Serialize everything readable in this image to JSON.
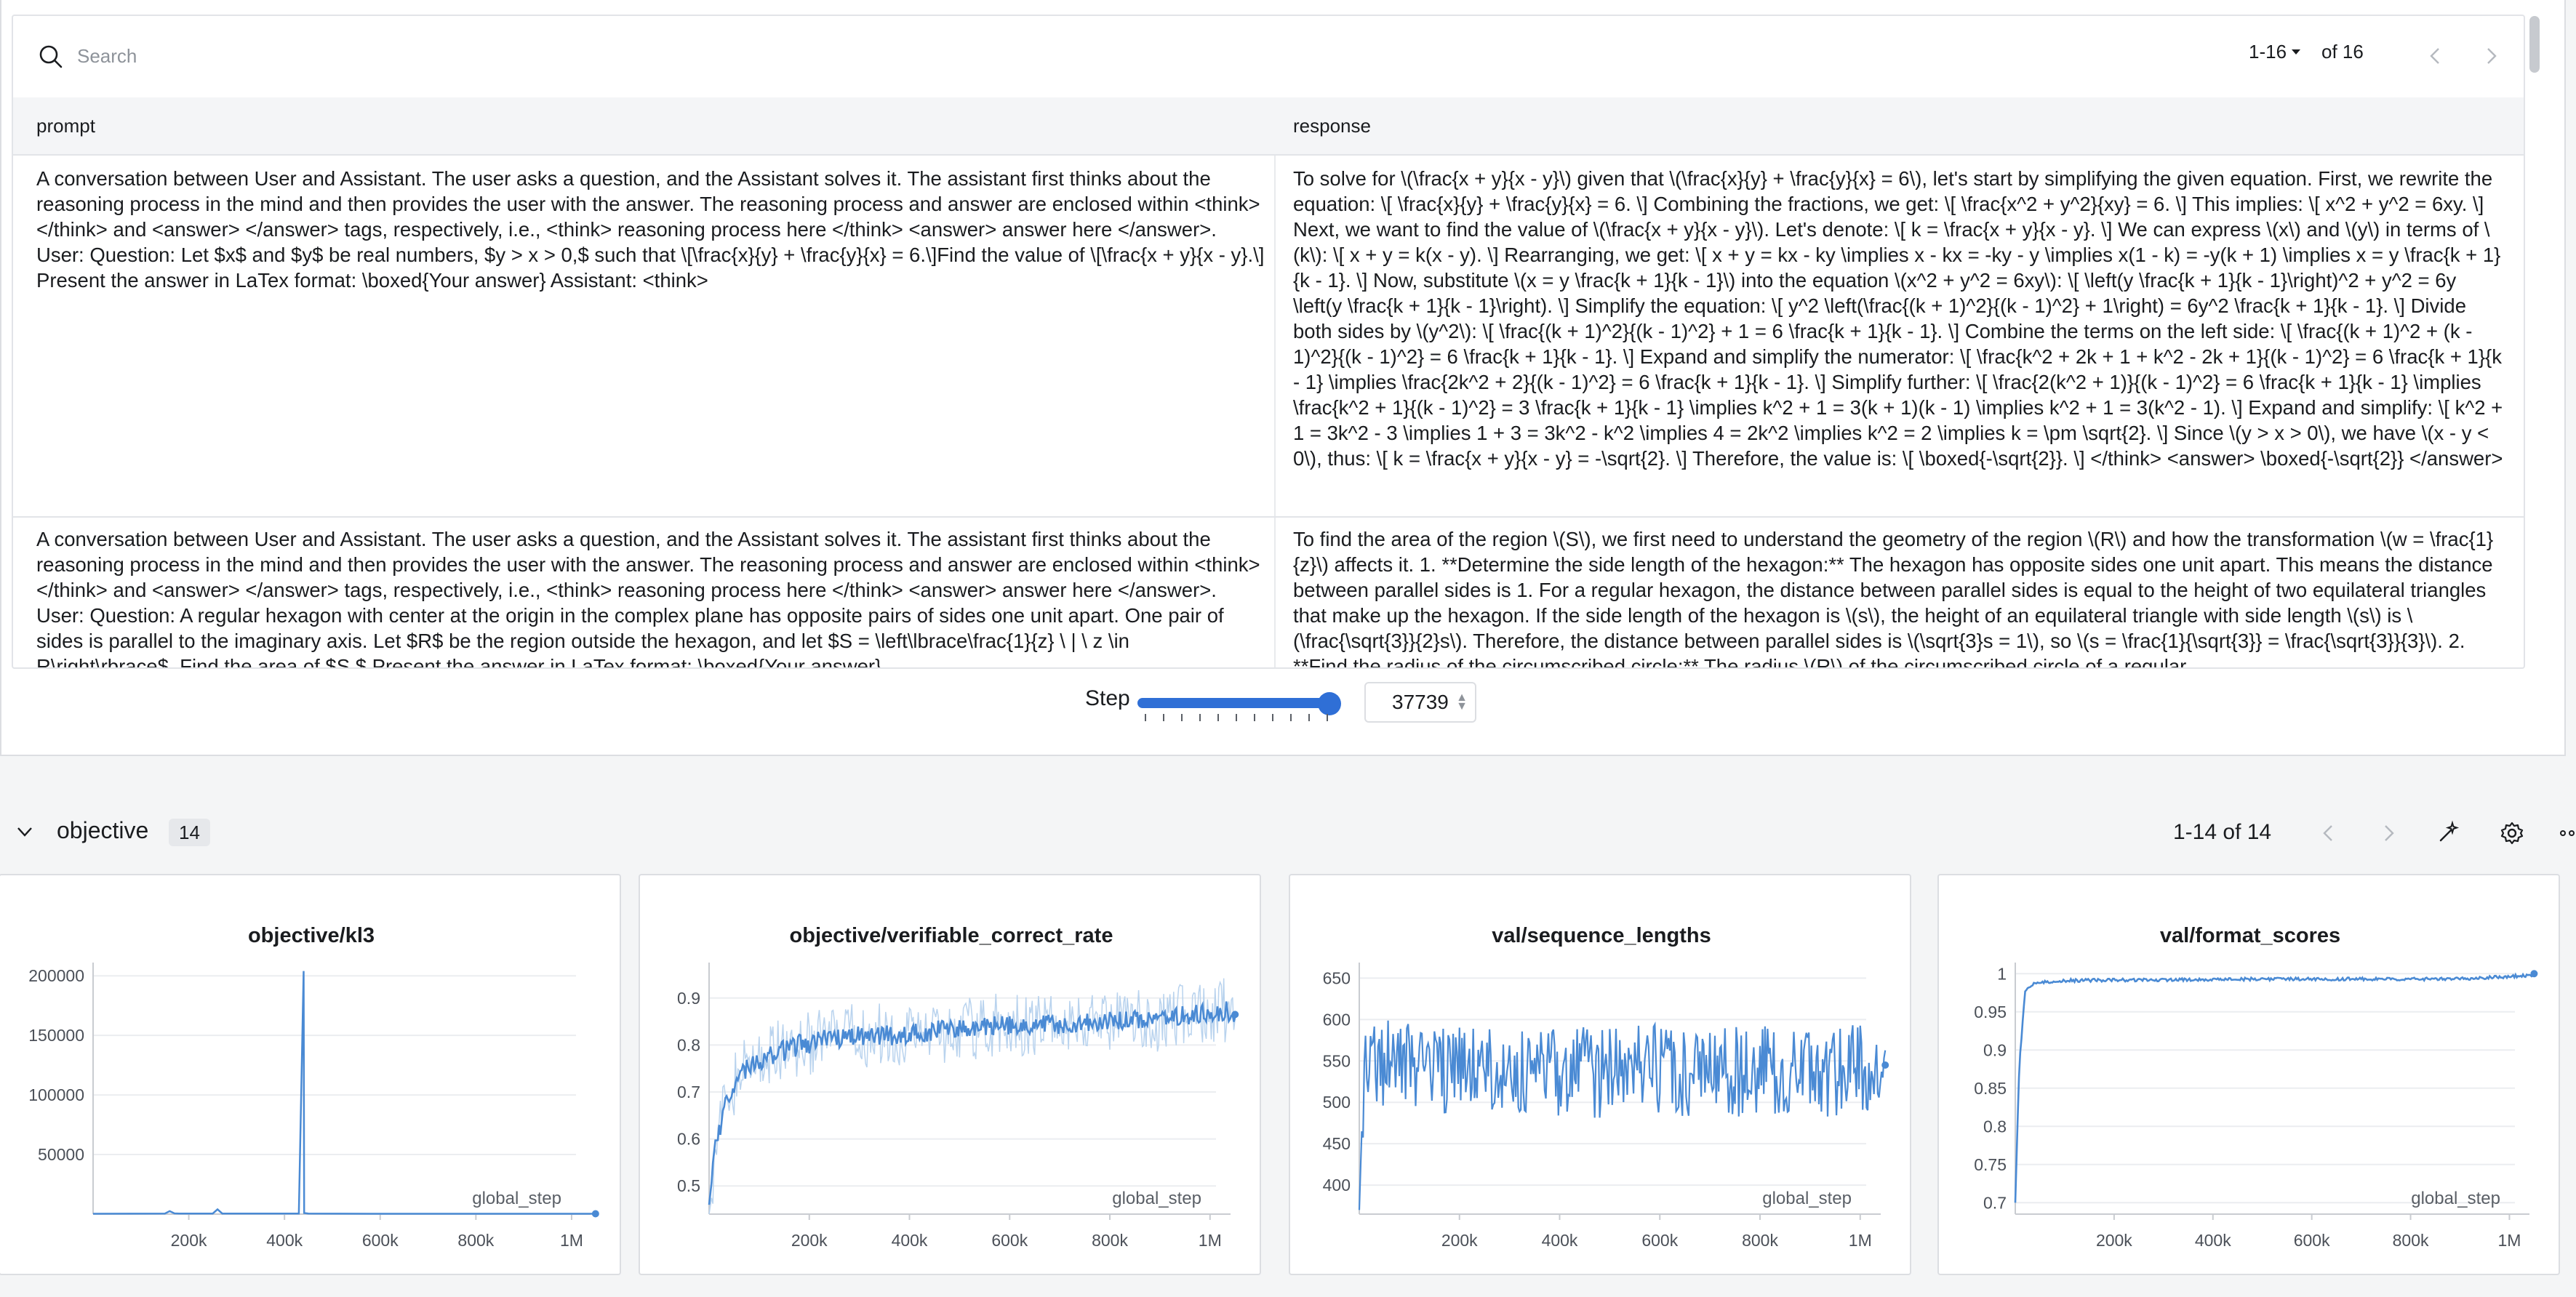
{
  "search": {
    "placeholder": "Search",
    "value": ""
  },
  "pager": {
    "range": "1-16",
    "of": "of 16"
  },
  "table": {
    "columns": [
      "prompt",
      "response"
    ],
    "rows": [
      {
        "prompt": "A conversation between User and Assistant. The user asks a question, and the Assistant solves it. The assistant first thinks about the reasoning process in the mind and then provides the user with the answer. The reasoning process and answer are enclosed within <think> </think> and <answer> </answer> tags, respectively, i.e., <think> reasoning process here </think> <answer> answer here </answer>. User: Question: Let $x$ and $y$ be real numbers, $y > x > 0,$ such that \\[\\frac{x}{y} + \\frac{y}{x} = 6.\\]Find the value of \\[\\frac{x + y}{x - y}.\\] Present the answer in LaTex format: \\boxed{Your answer} Assistant: <think>",
        "response": "To solve for \\(\\frac{x + y}{x - y}\\) given that \\(\\frac{x}{y} + \\frac{y}{x} = 6\\), let's start by simplifying the given equation. First, we rewrite the equation: \\[ \\frac{x}{y} + \\frac{y}{x} = 6. \\] Combining the fractions, we get: \\[ \\frac{x^2 + y^2}{xy} = 6. \\] This implies: \\[ x^2 + y^2 = 6xy. \\] Next, we want to find the value of \\(\\frac{x + y}{x - y}\\). Let's denote: \\[ k = \\frac{x + y}{x - y}. \\] We can express \\(x\\) and \\(y\\) in terms of \\(k\\): \\[ x + y = k(x - y). \\] Rearranging, we get: \\[ x + y = kx - ky \\implies x - kx = -ky - y \\implies x(1 - k) = -y(k + 1) \\implies x = y \\frac{k + 1}{k - 1}. \\] Now, substitute \\(x = y \\frac{k + 1}{k - 1}\\) into the equation \\(x^2 + y^2 = 6xy\\): \\[ \\left(y \\frac{k + 1}{k - 1}\\right)^2 + y^2 = 6y \\left(y \\frac{k + 1}{k - 1}\\right). \\] Simplify the equation: \\[ y^2 \\left(\\frac{(k + 1)^2}{(k - 1)^2} + 1\\right) = 6y^2 \\frac{k + 1}{k - 1}. \\] Divide both sides by \\(y^2\\): \\[ \\frac{(k + 1)^2}{(k - 1)^2} + 1 = 6 \\frac{k + 1}{k - 1}. \\] Combine the terms on the left side: \\[ \\frac{(k + 1)^2 + (k - 1)^2}{(k - 1)^2} = 6 \\frac{k + 1}{k - 1}. \\] Expand and simplify the numerator: \\[ \\frac{k^2 + 2k + 1 + k^2 - 2k + 1}{(k - 1)^2} = 6 \\frac{k + 1}{k - 1} \\implies \\frac{2k^2 + 2}{(k - 1)^2} = 6 \\frac{k + 1}{k - 1}. \\] Simplify further: \\[ \\frac{2(k^2 + 1)}{(k - 1)^2} = 6 \\frac{k + 1}{k - 1} \\implies \\frac{k^2 + 1}{(k - 1)^2} = 3 \\frac{k + 1}{k - 1} \\implies k^2 + 1 = 3(k + 1)(k - 1) \\implies k^2 + 1 = 3(k^2 - 1). \\] Expand and simplify: \\[ k^2 + 1 = 3k^2 - 3 \\implies 1 + 3 = 3k^2 - k^2 \\implies 4 = 2k^2 \\implies k^2 = 2 \\implies k = \\pm \\sqrt{2}. \\] Since \\(y > x > 0\\), we have \\(x - y < 0\\), thus: \\[ k = \\frac{x + y}{x - y} = -\\sqrt{2}. \\] Therefore, the value is: \\[ \\boxed{-\\sqrt{2}}. \\] </think> <answer> \\boxed{-\\sqrt{2}} </answer>"
      },
      {
        "prompt": "A conversation between User and Assistant. The user asks a question, and the Assistant solves it. The assistant first thinks about the reasoning process in the mind and then provides the user with the answer. The reasoning process and answer are enclosed within <think> </think> and <answer> </answer> tags, respectively, i.e., <think> reasoning process here </think> <answer> answer here </answer>. User: Question: A regular hexagon with center at the origin in the complex plane has opposite pairs of sides one unit apart. One pair of sides is parallel to the imaginary axis. Let $R$ be the region outside the hexagon, and let $S = \\left\\lbrace\\frac{1}{z} \\ | \\ z \\in R\\right\\rbrace$. Find the area of $S.$ Present the answer in LaTex format: \\boxed{Your answer}",
        "response": "To find the area of the region \\(S\\), we first need to understand the geometry of the region \\(R\\) and how the transformation \\(w = \\frac{1}{z}\\) affects it. 1. **Determine the side length of the hexagon:** The hexagon has opposite sides one unit apart. This means the distance between parallel sides is 1. For a regular hexagon, the distance between parallel sides is equal to the height of two equilateral triangles that make up the hexagon. If the side length of the hexagon is \\(s\\), the height of an equilateral triangle with side length \\(s\\) is \\(\\frac{\\sqrt{3}}{2}s\\). Therefore, the distance between parallel sides is \\(\\sqrt{3}s = 1\\), so \\(s = \\frac{1}{\\sqrt{3}} = \\frac{\\sqrt{3}}{3}\\). 2. **Find the radius of the circumscribed circle:** The radius \\(R\\) of the circumscribed circle of a regular"
      }
    ]
  },
  "step": {
    "label": "Step",
    "value": "37739",
    "slider_fraction": 1.0
  },
  "section": {
    "title": "objective",
    "count": "14",
    "range": "1-14 of 14"
  },
  "colors": {
    "accent": "#2f6fd6",
    "line": "#4a8ad4",
    "line_light": "#b9d3ee",
    "grid": "#ebedf0"
  },
  "chart_data": [
    {
      "type": "line",
      "title": "objective/kl3",
      "xlabel": "global_step",
      "x_ticks": [
        "200k",
        "400k",
        "600k",
        "800k",
        "1M"
      ],
      "y_ticks": [
        "50000",
        "100000",
        "150000",
        "200000"
      ],
      "xlim": [
        0,
        1070000
      ],
      "ylim": [
        0,
        205000
      ],
      "series": [
        {
          "x": [
            0,
            150000,
            160000,
            170000,
            180000,
            250000,
            260000,
            270000,
            430000,
            440000,
            441000,
            450000,
            600000,
            800000,
            1000000,
            1050000
          ],
          "y": [
            300,
            500,
            2500,
            600,
            400,
            500,
            4000,
            500,
            500,
            204000,
            900,
            400,
            300,
            300,
            300,
            300
          ]
        }
      ]
    },
    {
      "type": "line",
      "title": "objective/verifiable_correct_rate",
      "xlabel": "global_step",
      "x_ticks": [
        "200k",
        "400k",
        "600k",
        "800k",
        "1M"
      ],
      "y_ticks": [
        "0.5",
        "0.6",
        "0.7",
        "0.8",
        "0.9"
      ],
      "xlim": [
        0,
        1070000
      ],
      "ylim": [
        0.44,
        0.96
      ],
      "series": [
        {
          "x": [
            0,
            15000,
            40000,
            80000,
            130000,
            180000,
            230000,
            300000,
            380000,
            450000,
            520000,
            580000,
            650000,
            720000,
            800000,
            860000,
            920000,
            980000,
            1030000,
            1050000
          ],
          "y": [
            0.46,
            0.6,
            0.7,
            0.76,
            0.78,
            0.8,
            0.81,
            0.82,
            0.82,
            0.83,
            0.835,
            0.84,
            0.845,
            0.845,
            0.855,
            0.85,
            0.86,
            0.865,
            0.875,
            0.865
          ]
        }
      ]
    },
    {
      "type": "line",
      "title": "val/sequence_lengths",
      "xlabel": "global_step",
      "x_ticks": [
        "200k",
        "400k",
        "600k",
        "800k",
        "1M"
      ],
      "y_ticks": [
        "400",
        "450",
        "500",
        "550",
        "600",
        "650"
      ],
      "xlim": [
        0,
        1070000
      ],
      "ylim": [
        365,
        660
      ],
      "series": [
        {
          "x": [
            0,
            10000,
            60000,
            120000,
            200000,
            300000,
            400000,
            500000,
            600000,
            700000,
            800000,
            900000,
            1000000,
            1050000
          ],
          "y": [
            370,
            560,
            545,
            540,
            540,
            535,
            538,
            535,
            540,
            537,
            538,
            536,
            540,
            545
          ]
        }
      ]
    },
    {
      "type": "line",
      "title": "val/format_scores",
      "xlabel": "global_step",
      "x_ticks": [
        "200k",
        "400k",
        "600k",
        "800k",
        "1M"
      ],
      "y_ticks": [
        "0.7",
        "0.75",
        "0.8",
        "0.85",
        "0.9",
        "0.95",
        "1"
      ],
      "xlim": [
        0,
        1070000
      ],
      "ylim": [
        0.685,
        1.005
      ],
      "series": [
        {
          "x": [
            0,
            8000,
            20000,
            40000,
            100000,
            300000,
            500000,
            700000,
            900000,
            1050000
          ],
          "y": [
            0.7,
            0.88,
            0.98,
            0.99,
            0.993,
            0.994,
            0.995,
            0.995,
            0.995,
            1.0
          ]
        }
      ]
    }
  ]
}
